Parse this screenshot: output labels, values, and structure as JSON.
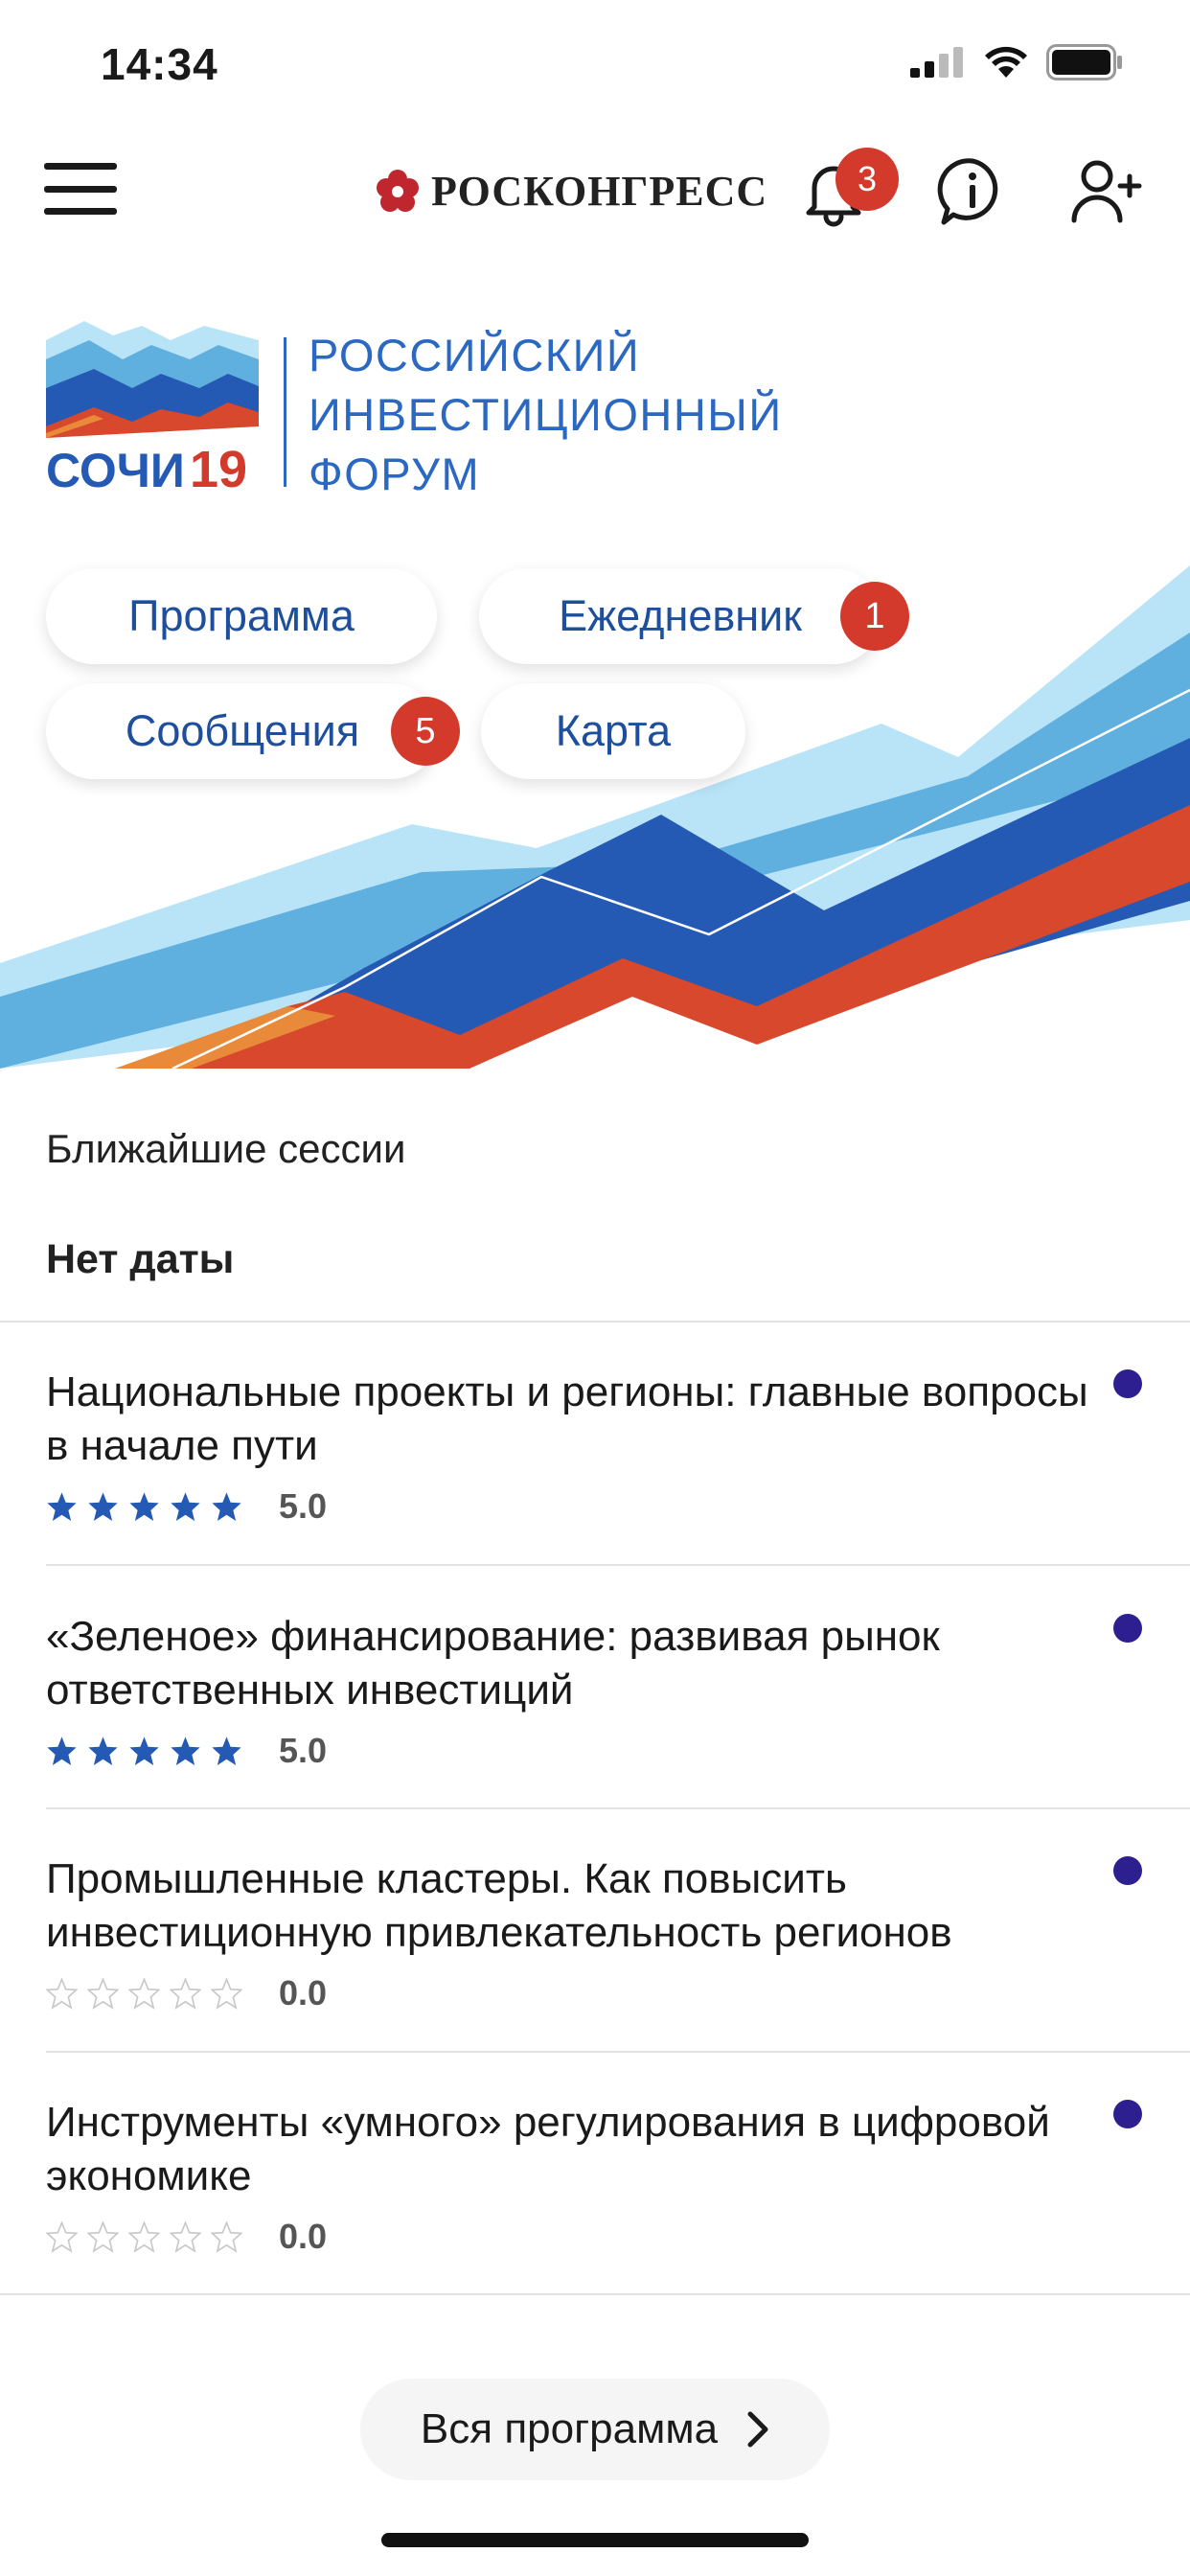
{
  "status_bar": {
    "time": "14:34"
  },
  "header": {
    "brand": "РОСКОНГРЕСС",
    "notifications_count": "3"
  },
  "forum": {
    "logo_text": "СОЧИ",
    "logo_year": "19",
    "title_lines": [
      "РОССИЙСКИЙ",
      "ИНВЕСТИЦИОННЫЙ",
      "ФОРУМ"
    ]
  },
  "nav_pills": [
    {
      "label": "Программа"
    },
    {
      "label": "Ежедневник",
      "badge": "1"
    },
    {
      "label": "Сообщения",
      "badge": "5"
    },
    {
      "label": "Карта"
    }
  ],
  "section_title": "Ближайшие сессии",
  "date_heading": "Нет даты",
  "sessions": [
    {
      "title": "Национальные проекты и регионы: главные вопросы в начале пути",
      "rating": 5.0,
      "rating_text": "5.0"
    },
    {
      "title": "«Зеленое» финансирование: развивая рынок ответственных инвестиций",
      "rating": 5.0,
      "rating_text": "5.0"
    },
    {
      "title": "Промышленные кластеры. Как повысить инвестиционную привлекательность регионов",
      "rating": 0.0,
      "rating_text": "0.0"
    },
    {
      "title": "Инструменты «умного» регулирования в цифровой экономике",
      "rating": 0.0,
      "rating_text": "0.0"
    }
  ],
  "all_program_button": "Вся программа",
  "colors": {
    "accent_blue": "#2a68c2",
    "pill_text": "#1e4f9c",
    "badge_red": "#d33a2c",
    "star_filled": "#2459b4",
    "session_dot": "#2d1f8f"
  }
}
